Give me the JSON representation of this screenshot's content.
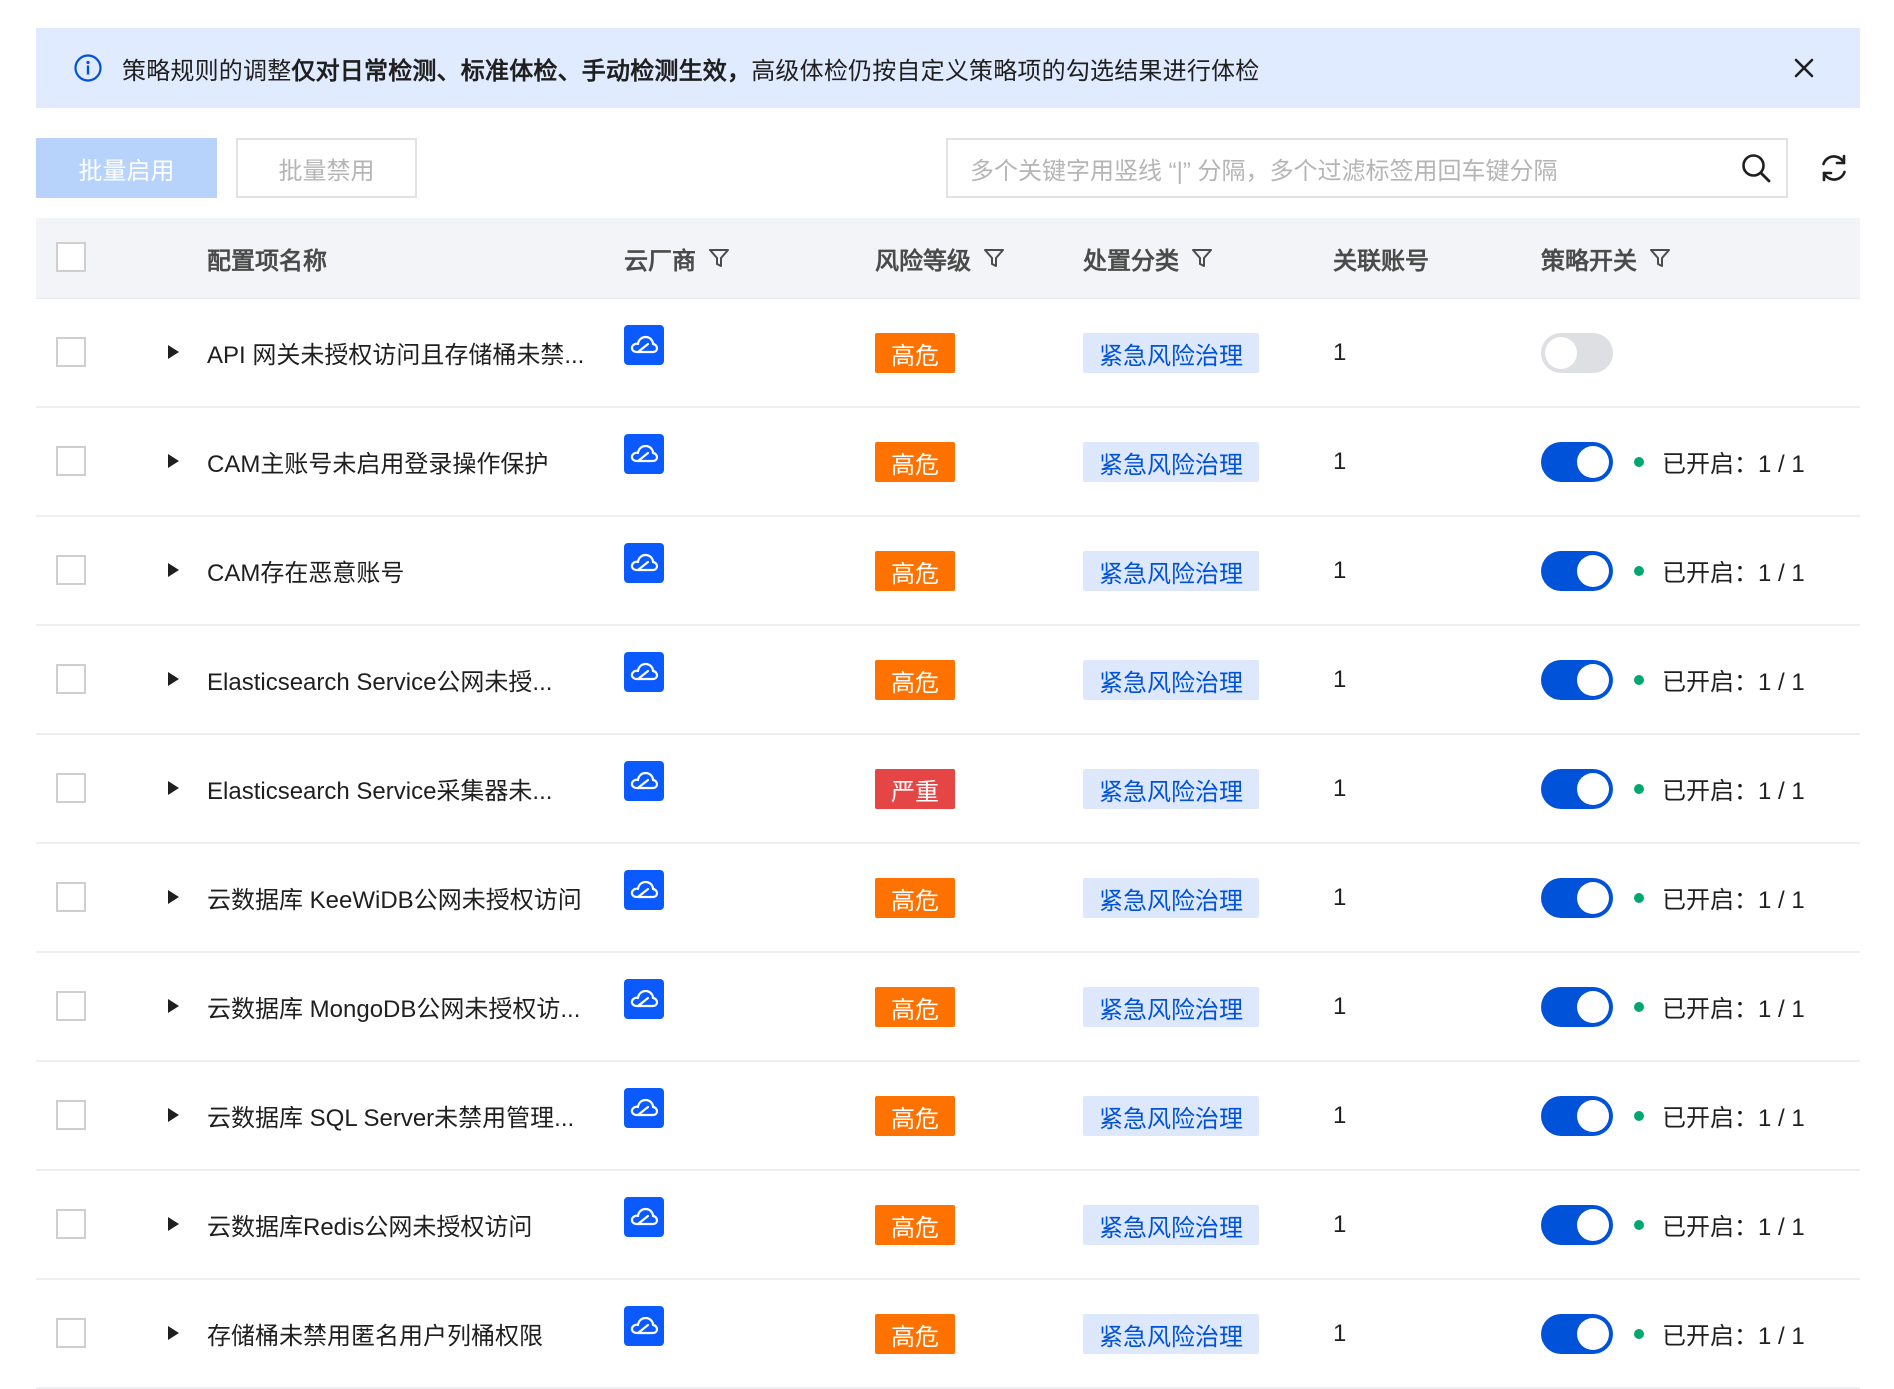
{
  "notice": {
    "prefix": "策略规则的调整",
    "bold": "仅对日常检测、标准体检、手动检测生效，",
    "suffix": "高级体检仍按自定义策略项的勾选结果进行体检"
  },
  "toolbar": {
    "enable_label": "批量启用",
    "disable_label": "批量禁用",
    "search_placeholder": "多个关键字用竖线 “|” 分隔，多个过滤标签用回车键分隔"
  },
  "table": {
    "headers": {
      "name": "配置项名称",
      "cloud": "云厂商",
      "risk": "风险等级",
      "category": "处置分类",
      "account": "关联账号",
      "switch": "策略开关"
    },
    "rows": [
      {
        "name": "API 网关未授权访问且存储桶未禁...",
        "risk": "高危",
        "risk_level": "high",
        "category": "紧急风险治理",
        "account": "1",
        "enabled": false,
        "status": ""
      },
      {
        "name": "CAM主账号未启用登录操作保护",
        "risk": "高危",
        "risk_level": "high",
        "category": "紧急风险治理",
        "account": "1",
        "enabled": true,
        "status": "已开启：1 / 1"
      },
      {
        "name": "CAM存在恶意账号",
        "risk": "高危",
        "risk_level": "high",
        "category": "紧急风险治理",
        "account": "1",
        "enabled": true,
        "status": "已开启：1 / 1"
      },
      {
        "name": "Elasticsearch Service公网未授...",
        "risk": "高危",
        "risk_level": "high",
        "category": "紧急风险治理",
        "account": "1",
        "enabled": true,
        "status": "已开启：1 / 1"
      },
      {
        "name": "Elasticsearch Service采集器未...",
        "risk": "严重",
        "risk_level": "critical",
        "category": "紧急风险治理",
        "account": "1",
        "enabled": true,
        "status": "已开启：1 / 1"
      },
      {
        "name": "云数据库 KeeWiDB公网未授权访问",
        "risk": "高危",
        "risk_level": "high",
        "category": "紧急风险治理",
        "account": "1",
        "enabled": true,
        "status": "已开启：1 / 1"
      },
      {
        "name": "云数据库 MongoDB公网未授权访...",
        "risk": "高危",
        "risk_level": "high",
        "category": "紧急风险治理",
        "account": "1",
        "enabled": true,
        "status": "已开启：1 / 1"
      },
      {
        "name": "云数据库 SQL Server未禁用管理...",
        "risk": "高危",
        "risk_level": "high",
        "category": "紧急风险治理",
        "account": "1",
        "enabled": true,
        "status": "已开启：1 / 1"
      },
      {
        "name": "云数据库Redis公网未授权访问",
        "risk": "高危",
        "risk_level": "high",
        "category": "紧急风险治理",
        "account": "1",
        "enabled": true,
        "status": "已开启：1 / 1"
      },
      {
        "name": "存储桶未禁用匿名用户列桶权限",
        "risk": "高危",
        "risk_level": "high",
        "category": "紧急风险治理",
        "account": "1",
        "enabled": true,
        "status": "已开启：1 / 1"
      }
    ]
  },
  "icons": {
    "notice": "info-circle-icon",
    "close": "close-icon",
    "search": "search-icon",
    "refresh": "refresh-icon",
    "filter": "filter-icon",
    "expand": "caret-right-icon",
    "cloud": "tencent-cloud-icon"
  },
  "colors": {
    "primary": "#0052d9",
    "banner_bg": "#e0ebff",
    "risk_high": "#ff7200",
    "risk_critical": "#e54545",
    "status_dot": "#00a870"
  }
}
